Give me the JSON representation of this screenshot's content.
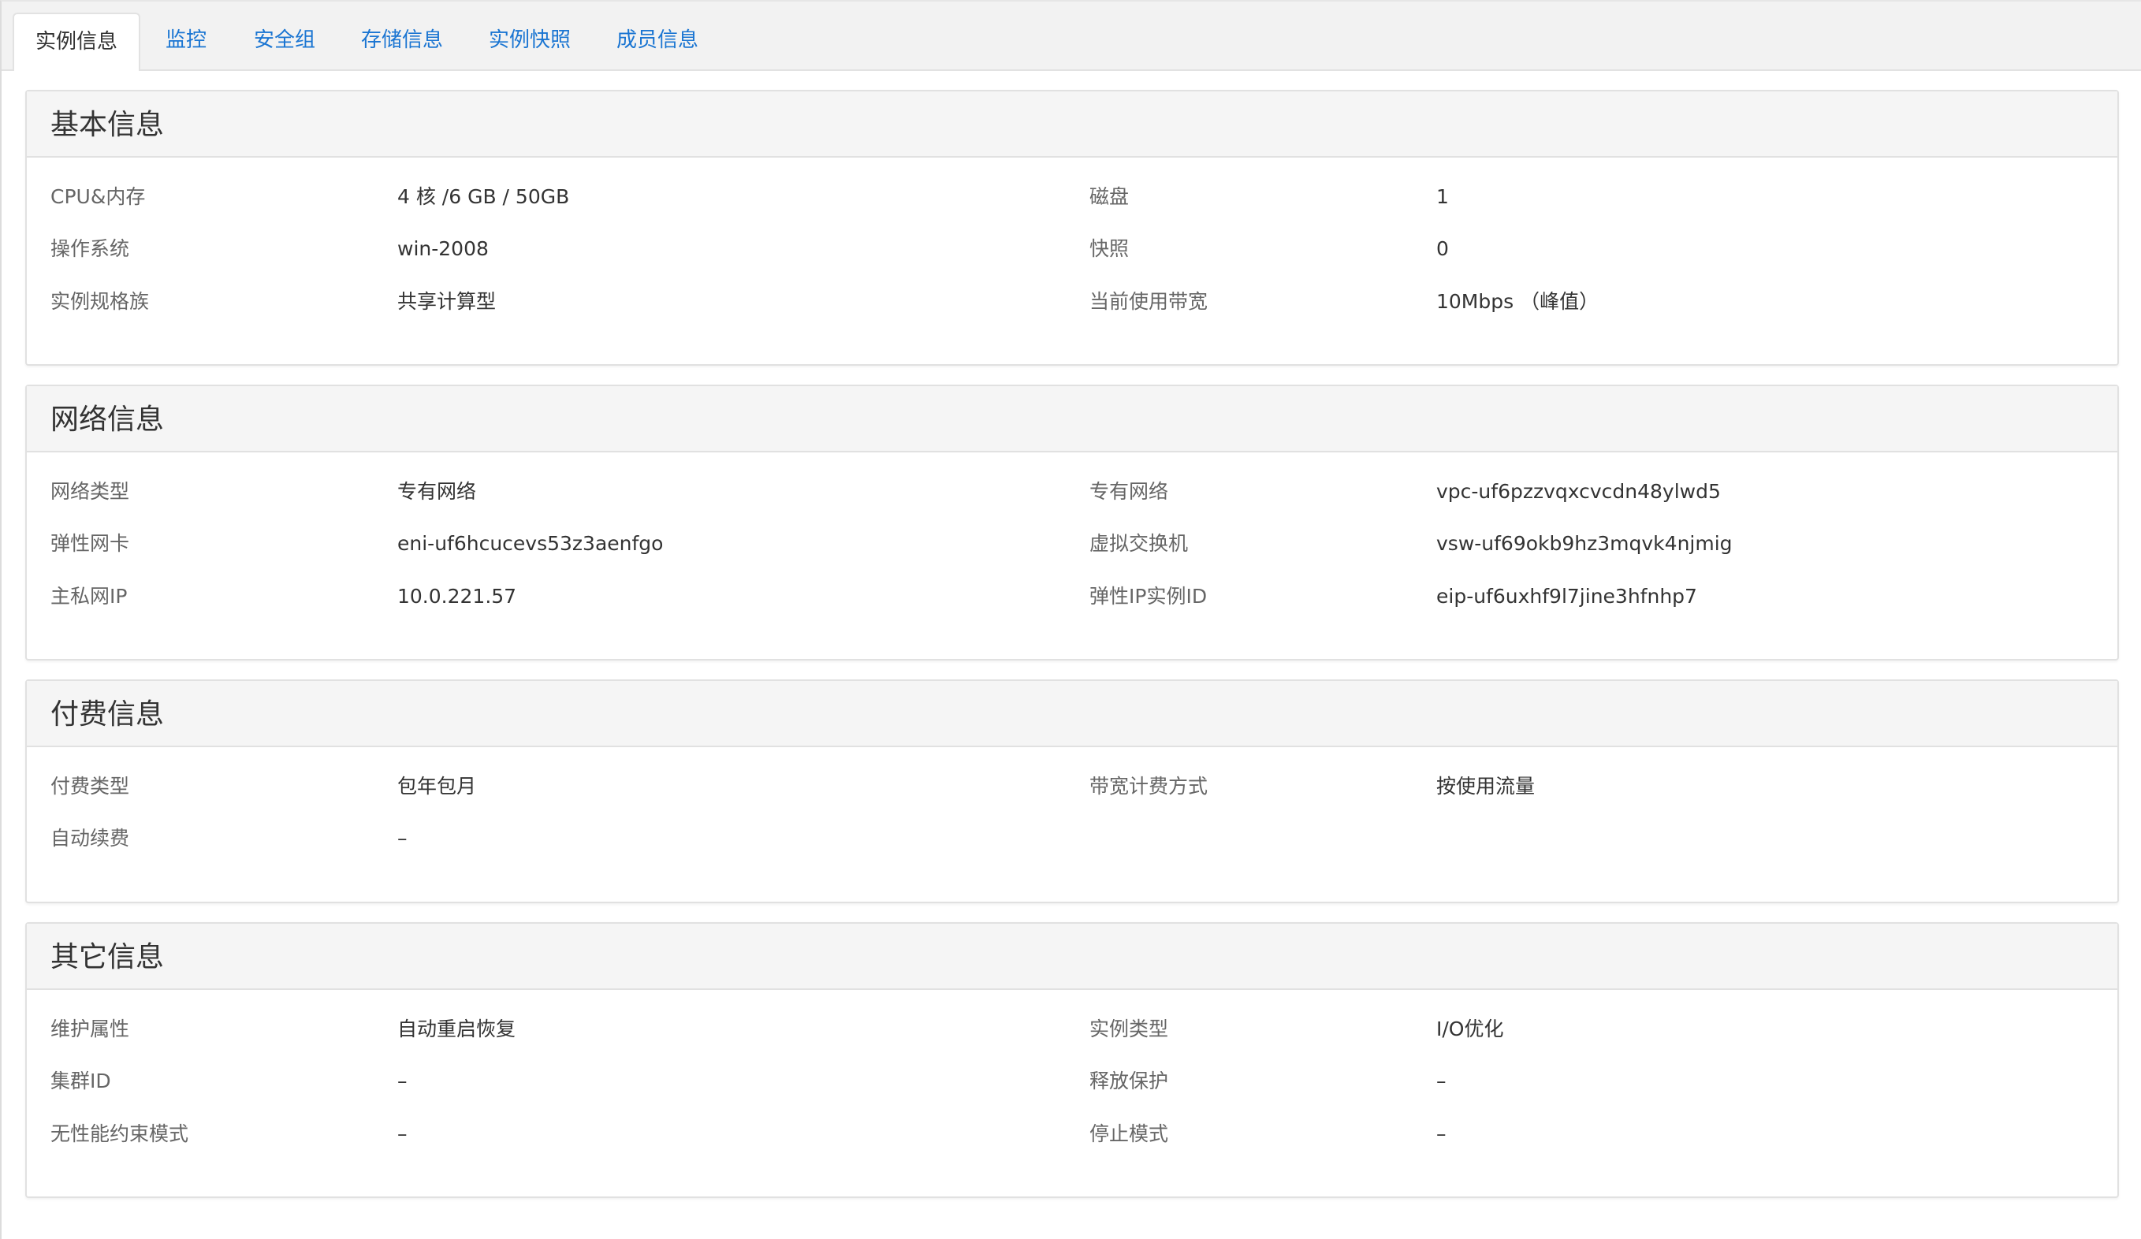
{
  "tabs": [
    {
      "label": "实例信息",
      "active": true
    },
    {
      "label": "监控",
      "active": false
    },
    {
      "label": "安全组",
      "active": false
    },
    {
      "label": "存储信息",
      "active": false
    },
    {
      "label": "实例快照",
      "active": false
    },
    {
      "label": "成员信息",
      "active": false
    }
  ],
  "sections": {
    "basic": {
      "title": "基本信息",
      "rows": [
        {
          "label1": "CPU&内存",
          "value1": "4 核 /6 GB / 50GB",
          "label2": "磁盘",
          "value2": "1"
        },
        {
          "label1": "操作系统",
          "value1": "win-2008",
          "label2": "快照",
          "value2": "0"
        },
        {
          "label1": "实例规格族",
          "value1": "共享计算型",
          "label2": "当前使用带宽",
          "value2": "10Mbps （峰值）"
        }
      ]
    },
    "network": {
      "title": "网络信息",
      "rows": [
        {
          "label1": "网络类型",
          "value1": "专有网络",
          "label2": "专有网络",
          "value2": "vpc-uf6pzzvqxcvcdn48ylwd5"
        },
        {
          "label1": "弹性网卡",
          "value1": "eni-uf6hcucevs53z3aenfgo",
          "label2": "虚拟交换机",
          "value2": "vsw-uf69okb9hz3mqvk4njmig"
        },
        {
          "label1": "主私网IP",
          "value1": "10.0.221.57",
          "label2": "弹性IP实例ID",
          "value2": "eip-uf6uxhf9l7jine3hfnhp7"
        }
      ]
    },
    "billing": {
      "title": "付费信息",
      "rows": [
        {
          "label1": "付费类型",
          "value1": "包年包月",
          "label2": "带宽计费方式",
          "value2": "按使用流量"
        },
        {
          "label1": "自动续费",
          "value1": "–"
        }
      ]
    },
    "other": {
      "title": "其它信息",
      "rows": [
        {
          "label1": "维护属性",
          "value1": "自动重启恢复",
          "label2": "实例类型",
          "value2": "I/O优化"
        },
        {
          "label1": "集群ID",
          "value1": "–",
          "label2": "释放保护",
          "value2": "–"
        },
        {
          "label1": "无性能约束模式",
          "value1": "–",
          "label2": "停止模式",
          "value2": "–"
        }
      ]
    }
  },
  "colors": {
    "link": "#1a75d2",
    "label": "#666666",
    "value": "#333333",
    "header_bg": "#f5f5f5",
    "border": "#e1e1e1"
  }
}
